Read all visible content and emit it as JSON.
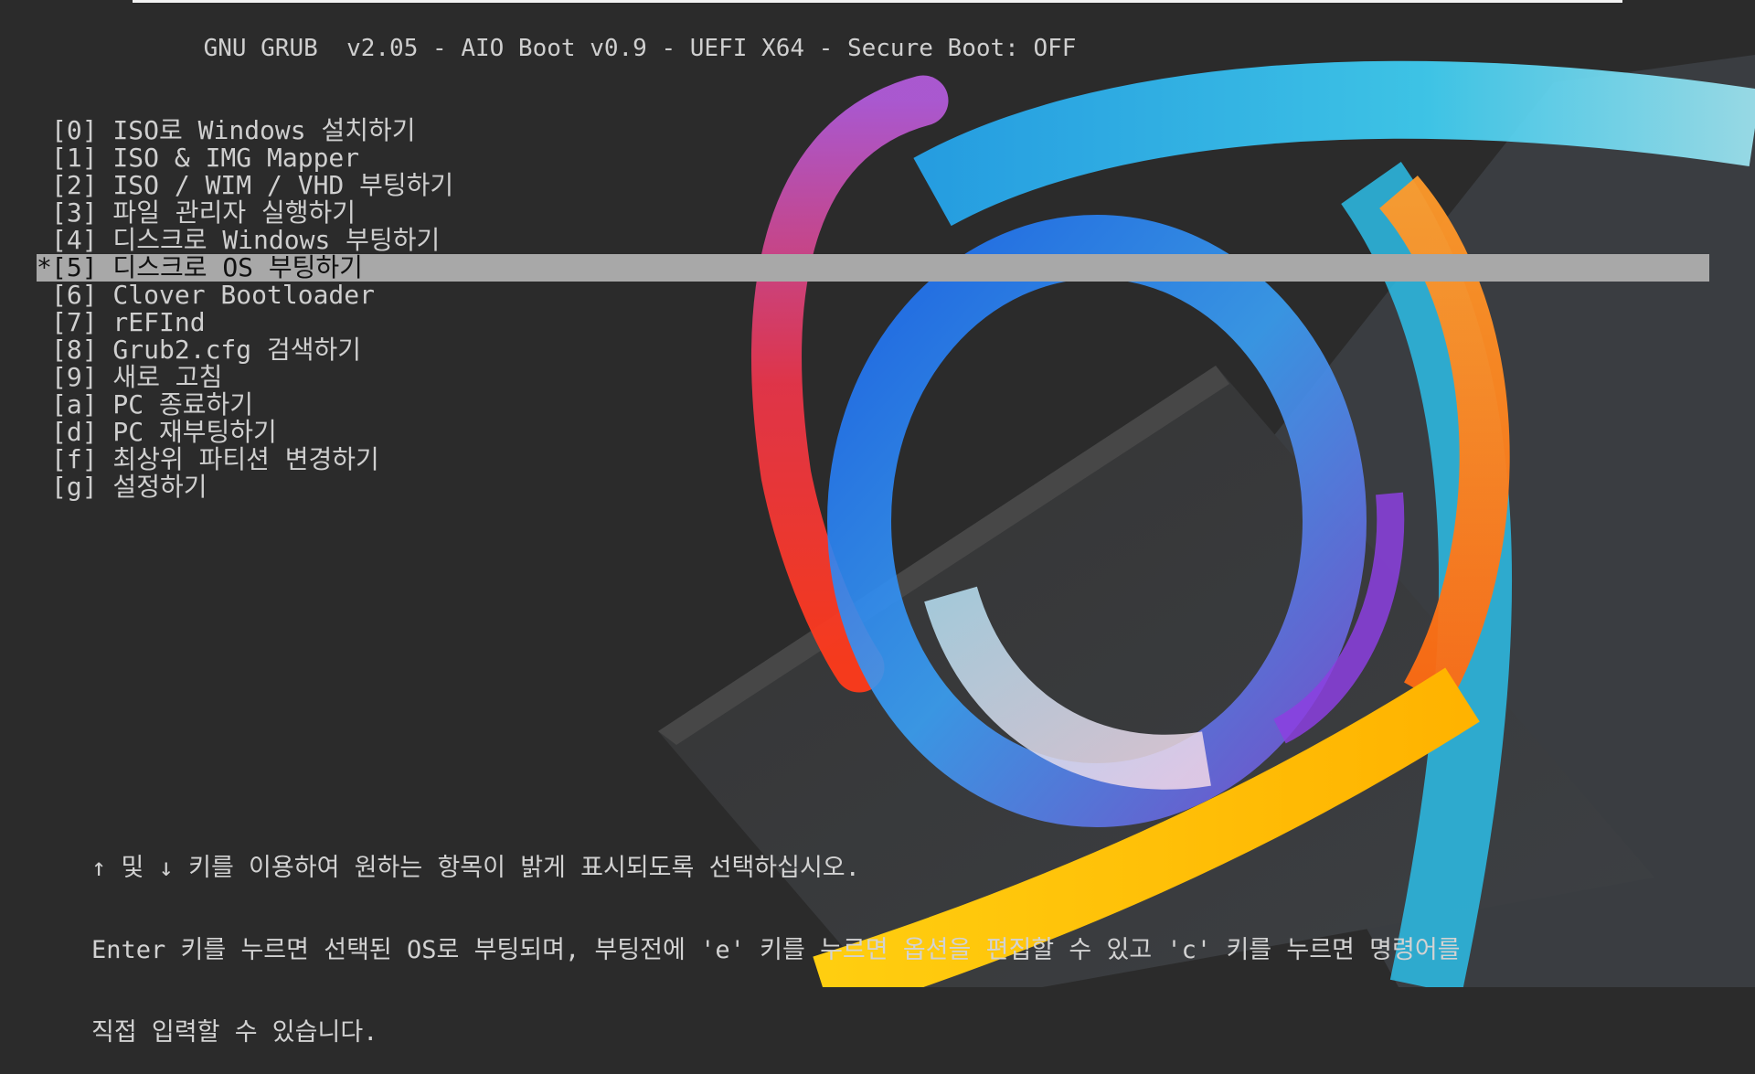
{
  "header": {
    "title": "GNU GRUB  v2.05 - AIO Boot v0.9 - UEFI X64 - Secure Boot: OFF"
  },
  "menu": {
    "selected_marker": "*",
    "items": [
      {
        "label": "[0] ISO로 Windows 설치하기"
      },
      {
        "label": "[1] ISO & IMG Mapper"
      },
      {
        "label": "[2] ISO / WIM / VHD 부팅하기"
      },
      {
        "label": "[3] 파일 관리자 실행하기"
      },
      {
        "label": "[4] 디스크로 Windows 부팅하기"
      },
      {
        "label": "[5] 디스크로 OS 부팅하기"
      },
      {
        "label": "[6] Clover Bootloader"
      },
      {
        "label": "[7] rEFInd"
      },
      {
        "label": "[8] Grub2.cfg 검색하기"
      },
      {
        "label": "[9] 새로 고침"
      },
      {
        "label": "[a] PC 종료하기"
      },
      {
        "label": "[d] PC 재부팅하기"
      },
      {
        "label": "[f] 최상위 파티션 변경하기"
      },
      {
        "label": "[g] 설정하기"
      }
    ]
  },
  "help": {
    "line1": "↑ 및 ↓ 키를 이용하여 원하는 항목이 밝게 표시되도록 선택하십시오.",
    "line2": "Enter 키를 누르면 선택된 OS로 부팅되며, 부팅전에 'e' 키를 누르면 옵션을 편집할 수 있고 'c' 키를 누르면 명령어를",
    "line3": "직접 입력할 수 있습니다."
  },
  "colors": {
    "background": "#2b2b2b",
    "text": "#cfcfcf",
    "highlight": "#a8a8a8"
  }
}
